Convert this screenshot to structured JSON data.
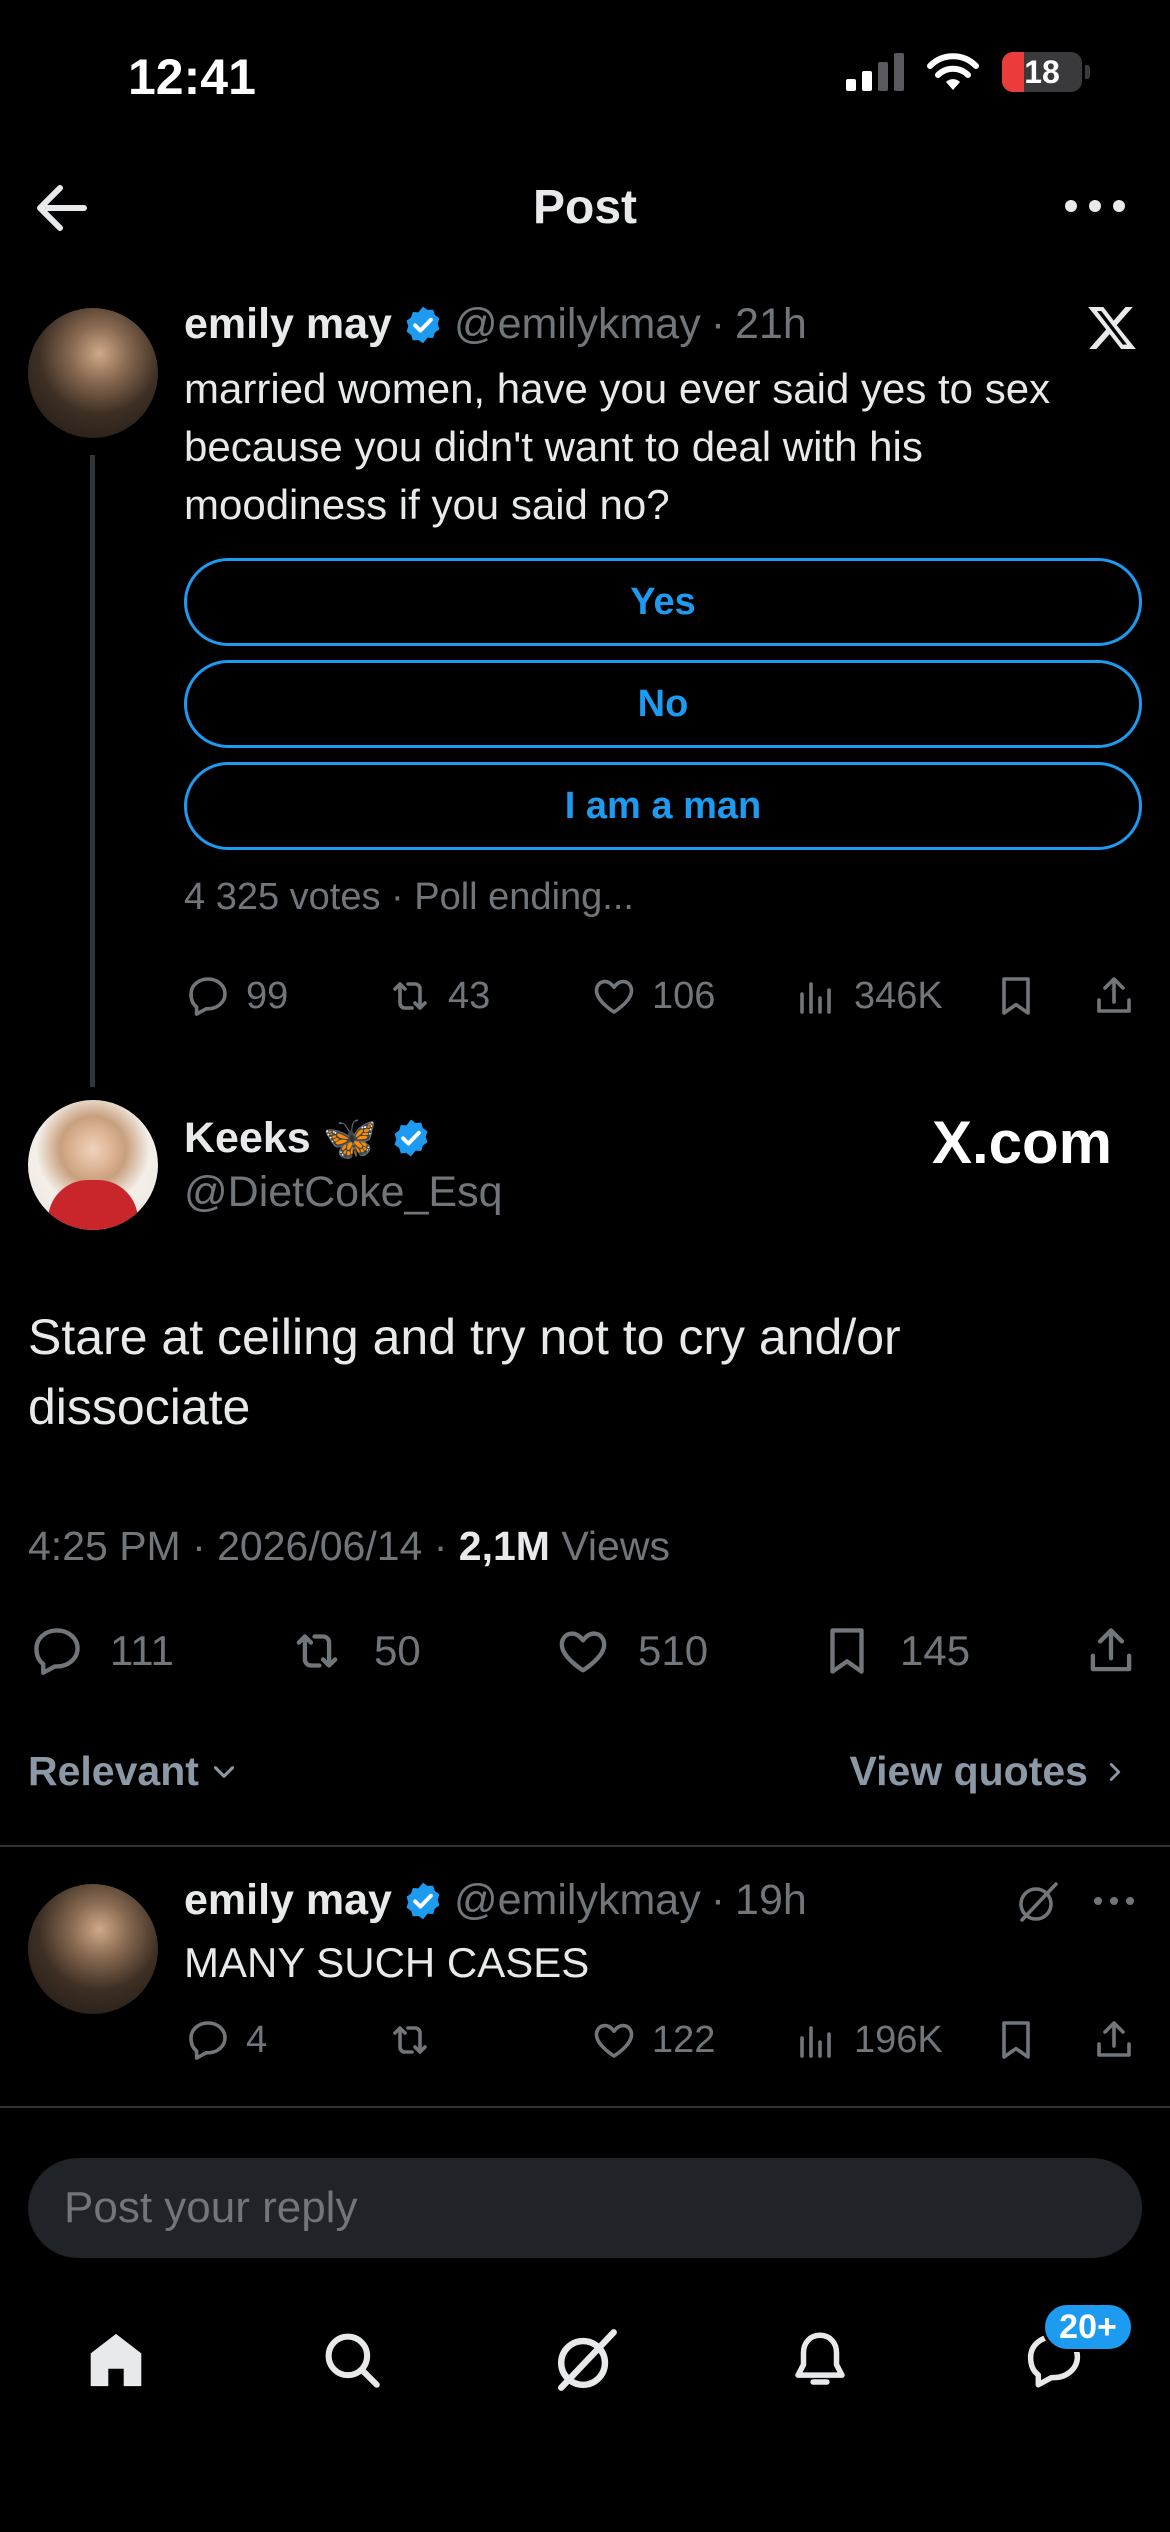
{
  "status_bar": {
    "time": "12:41",
    "battery": "18"
  },
  "header": {
    "title": "Post"
  },
  "original_post": {
    "author_name": "emily may",
    "handle": "@emilykmay",
    "separator": "·",
    "time": "21h",
    "text": "married women, have you ever said yes to sex because you didn't want to deal with his moodiness if you said no?",
    "poll_options": [
      "Yes",
      "No",
      "I am a man"
    ],
    "poll_meta": "4 325 votes · Poll ending...",
    "stats": {
      "replies": "99",
      "reposts": "43",
      "likes": "106",
      "views": "346K"
    }
  },
  "main_post": {
    "author_name": "Keeks",
    "author_emoji": "🦋",
    "handle": "@DietCoke_Esq",
    "watermark": "X.com",
    "text": "Stare at ceiling and try not to cry and/or dissociate",
    "meta_time": "4:25 PM · 2026/06/14 · ",
    "meta_views_count": "2,1M",
    "meta_views_label": " Views",
    "stats": {
      "replies": "111",
      "reposts": "50",
      "likes": "510",
      "bookmarks": "145"
    }
  },
  "sort": {
    "label": "Relevant",
    "quotes_label": "View quotes"
  },
  "reply": {
    "author_name": "emily may",
    "handle": "@emilykmay",
    "separator": "·",
    "time": "19h",
    "text": "MANY SUCH CASES",
    "stats": {
      "replies": "4",
      "reposts": "",
      "likes": "122",
      "views": "196K"
    }
  },
  "composer": {
    "placeholder": "Post your reply"
  },
  "tab_bar": {
    "messages_badge": "20+"
  },
  "colors": {
    "accent": "#1d9bf0",
    "muted": "#71767b",
    "background": "#000000"
  }
}
